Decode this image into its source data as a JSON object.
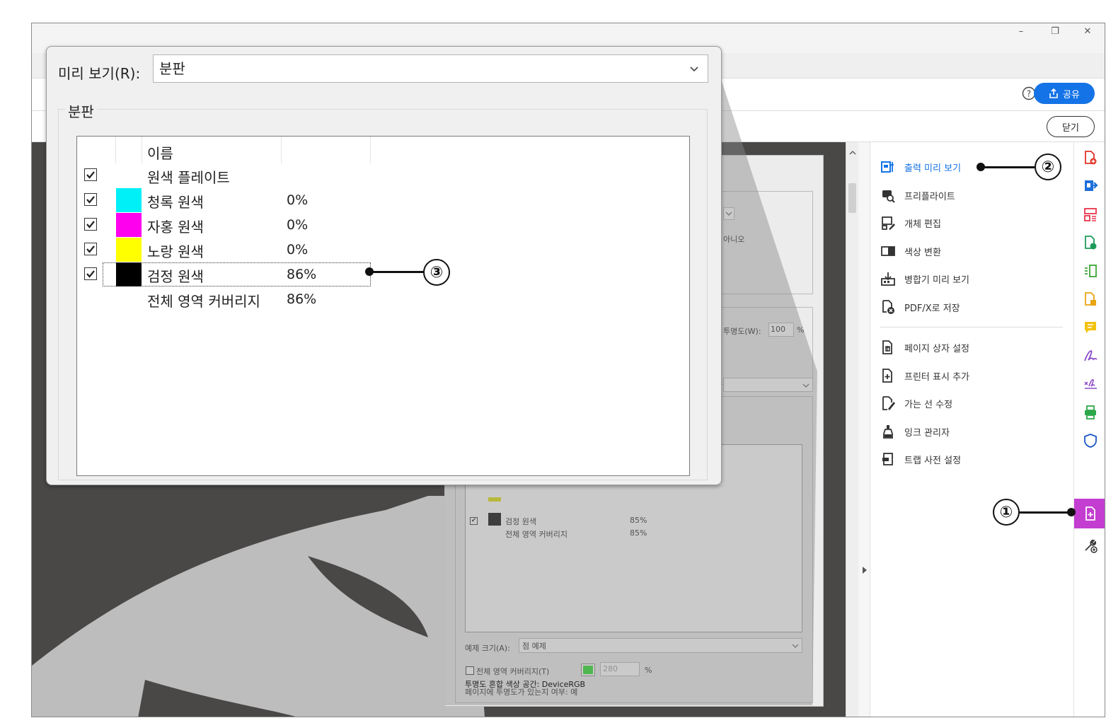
{
  "window": {
    "minimize": "–",
    "restore": "❐",
    "close": "✕"
  },
  "header": {
    "share_label": "공유",
    "close_label": "닫기"
  },
  "tools_panel": {
    "items": [
      {
        "label": "출력 미리 보기",
        "icon": "output-preview-icon",
        "active": true
      },
      {
        "label": "프리플라이트",
        "icon": "preflight-icon"
      },
      {
        "label": "개체 편집",
        "icon": "edit-object-icon"
      },
      {
        "label": "색상 변환",
        "icon": "convert-colors-icon"
      },
      {
        "label": "병합기 미리 보기",
        "icon": "flattener-preview-icon"
      },
      {
        "label": "PDF/X로 저장",
        "icon": "save-pdfx-icon"
      },
      {
        "label": "페이지 상자 설정",
        "icon": "set-page-boxes-icon"
      },
      {
        "label": "프린터 표시 추가",
        "icon": "add-printer-marks-icon"
      },
      {
        "label": "가는 선 수정",
        "icon": "fix-hairlines-icon"
      },
      {
        "label": "잉크 관리자",
        "icon": "ink-manager-icon"
      },
      {
        "label": "트랩 사전 설정",
        "icon": "trap-presets-icon"
      }
    ]
  },
  "background_dialog": {
    "no_label": "아니오",
    "opacity_label": "투명도(W):",
    "opacity_value": "100",
    "percent": "%",
    "rows": [
      {
        "name": "검정 원색",
        "value": "85%",
        "color": "#000000",
        "checked": true
      },
      {
        "name": "전체 영역 커버리지",
        "value": "85%"
      }
    ],
    "sample_size_label": "예제 크기(A):",
    "sample_size_value": "점 예제",
    "total_coverage_label": "전체 영역 커버리지(T)",
    "total_coverage_value": "280",
    "total_coverage_percent": "%",
    "transparency_info": "페이지에 투명도가 있는지 여부: 예",
    "blend_space_info": "투명도 혼합 색상 공간: DeviceRGB"
  },
  "preview_dialog": {
    "preview_label": "미리 보기(R):",
    "preview_value": "분판",
    "group_label": "분판",
    "column_name": "이름",
    "rows": [
      {
        "name": "원색 플레이트",
        "value": "",
        "color": "",
        "checked": true
      },
      {
        "name": "청록 원색",
        "value": "0%",
        "color": "#00f0f8",
        "checked": true
      },
      {
        "name": "자홍 원색",
        "value": "0%",
        "color": "#ff00ee",
        "checked": true
      },
      {
        "name": "노랑 원색",
        "value": "0%",
        "color": "#ffff00",
        "checked": true
      },
      {
        "name": "검정 원색",
        "value": "86%",
        "color": "#000000",
        "checked": true
      },
      {
        "name": "전체 영역 커버리지",
        "value": "86%",
        "color": "",
        "checked": false
      }
    ]
  },
  "callouts": [
    "①",
    "②",
    "③"
  ]
}
